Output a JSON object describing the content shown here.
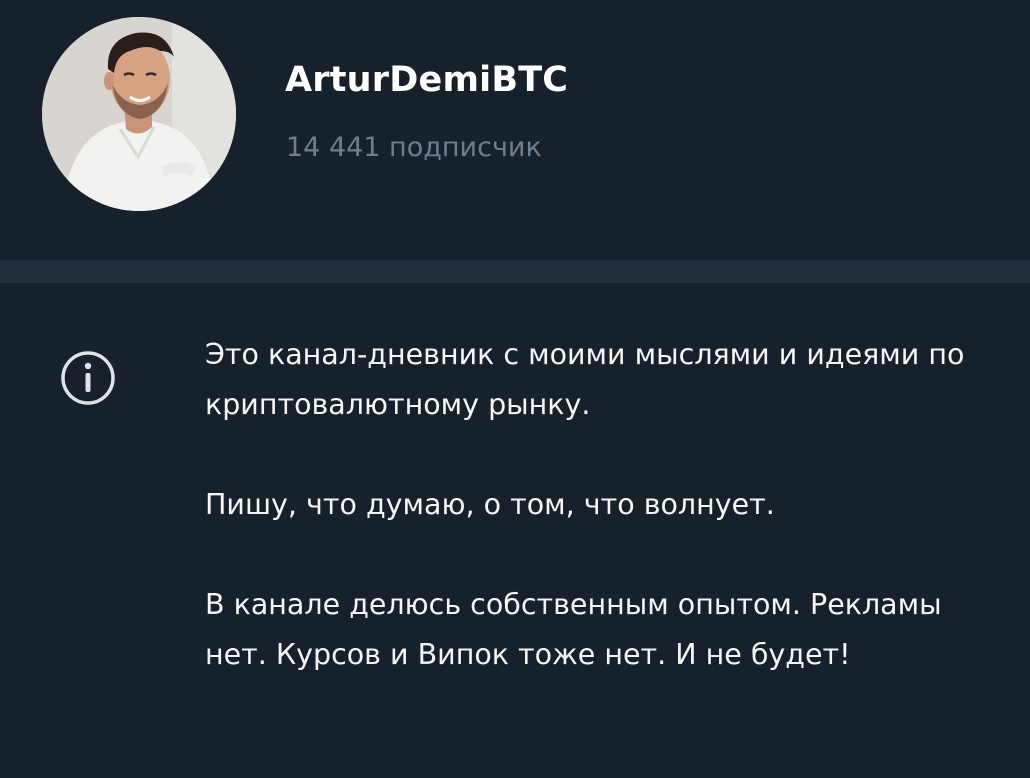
{
  "channel": {
    "name": "ArturDemiBTC",
    "subscribers": "14 441 подписчик"
  },
  "icons": {
    "info": "info-icon",
    "avatar": "avatar-photo"
  },
  "colors": {
    "background": "#17212b",
    "divider": "#232e3c",
    "title": "#ffffff",
    "subtitle": "#6d7f8f",
    "text": "#f5f5f5"
  },
  "description": {
    "p1": "Это канал-дневник с моими мыслями и идеями по криптовалютному рынку.",
    "p2": "Пишу, что думаю, о том, что волнует.",
    "p3": "В канале делюсь собственным опытом. Рекламы нет. Курсов и Випок тоже нет. И не будет!"
  }
}
